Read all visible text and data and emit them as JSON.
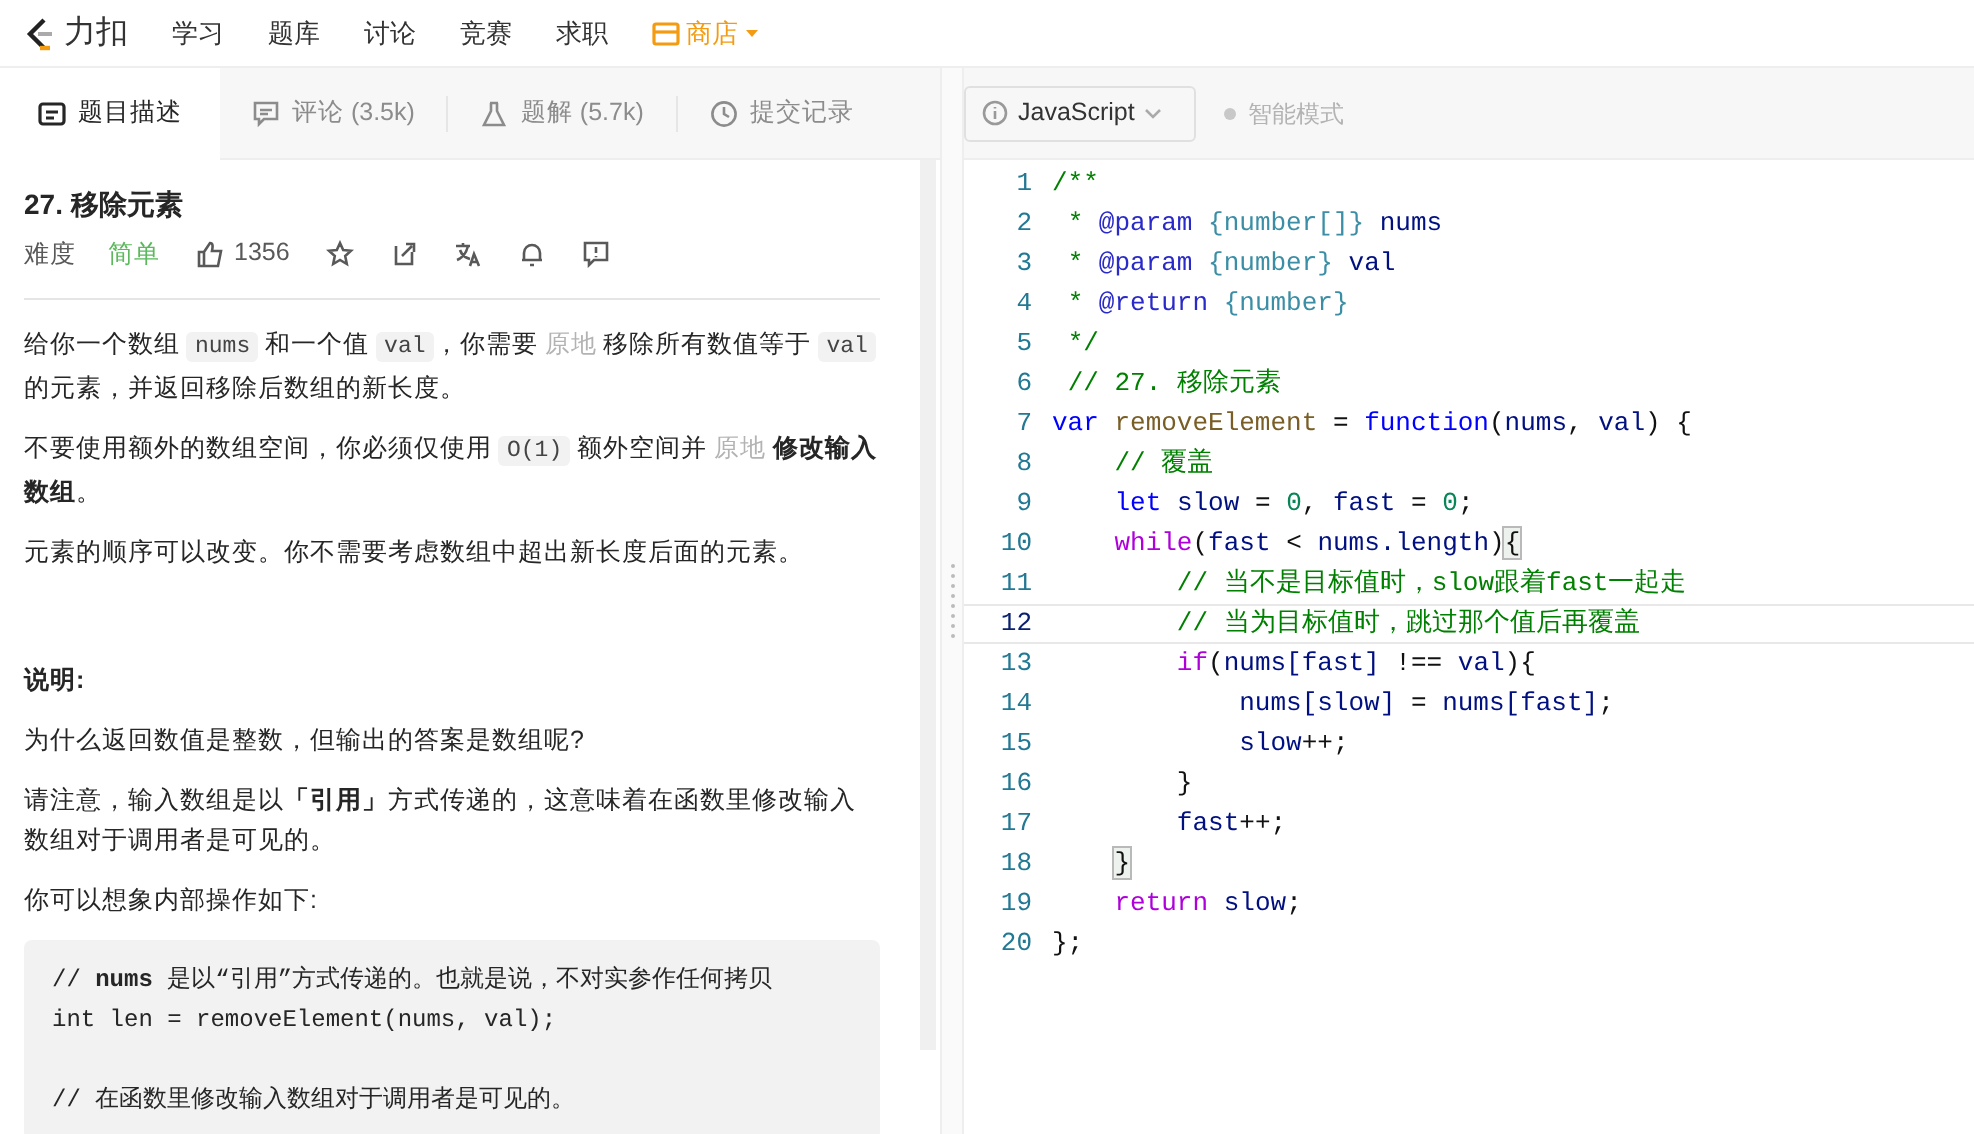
{
  "navbar": {
    "logo_text": "力扣",
    "items": [
      {
        "label": "学习",
        "kind": "link"
      },
      {
        "label": "题库",
        "kind": "link"
      },
      {
        "label": "讨论",
        "kind": "link"
      },
      {
        "label": "竞赛",
        "kind": "link"
      },
      {
        "label": "求职",
        "kind": "link"
      },
      {
        "label": "商店",
        "kind": "store"
      }
    ]
  },
  "tabs": [
    {
      "label": "题目描述",
      "selected": true
    },
    {
      "label": "评论 (3.5k)",
      "selected": false
    },
    {
      "label": "题解 (5.7k)",
      "selected": false
    },
    {
      "label": "提交记录",
      "selected": false
    }
  ],
  "problem": {
    "title": "27. 移除元素",
    "difficulty_label": "难度",
    "difficulty": "简单",
    "likes": "1356",
    "paragraphs": [
      [
        {
          "kind": "text",
          "text": "给你一个数组 "
        },
        {
          "kind": "code",
          "text": "nums"
        },
        {
          "kind": "text",
          "text": " 和一个值 "
        },
        {
          "kind": "code",
          "text": "val"
        },
        {
          "kind": "text",
          "text": "，你需要 "
        },
        {
          "kind": "muted",
          "text": "原地"
        },
        {
          "kind": "text",
          "text": " 移除所有数值等于 "
        },
        {
          "kind": "code",
          "text": "val"
        },
        {
          "kind": "text",
          "text": " 的元素，并返回移除后数组的新长度。"
        }
      ],
      [
        {
          "kind": "text",
          "text": "不要使用额外的数组空间，你必须仅使用 "
        },
        {
          "kind": "code",
          "text": "O(1)"
        },
        {
          "kind": "text",
          "text": " 额外空间并 "
        },
        {
          "kind": "muted",
          "text": "原地"
        },
        {
          "kind": "bold",
          "text": " 修改输入数组"
        },
        {
          "kind": "text",
          "text": "。"
        }
      ],
      [
        {
          "kind": "text",
          "text": "元素的顺序可以改变。你不需要考虑数组中超出新长度后面的元素。"
        }
      ]
    ],
    "note_heading": "说明:",
    "notes": [
      "为什么返回数值是整数，但输出的答案是数组呢?",
      "请注意，输入数组是以**「引用」**方式传递的，这意味着在函数里修改输入数组对于调用者是可见的。",
      "你可以想象内部操作如下:"
    ],
    "example_code": [
      [
        "// **nums** 是以“引用”方式传递的。也就是说，不对实参作任何拷贝",
        "int len = removeElement(nums, val);"
      ],
      [
        "// 在函数里修改输入数组对于调用者是可见的。"
      ]
    ]
  },
  "editor_toolbar": {
    "language": "JavaScript",
    "smart_mode": {
      "label": "智能模式",
      "on": false
    }
  },
  "editor": {
    "lines": [
      {
        "number": "1",
        "selected": false,
        "tokens": [
          {
            "kind": "comment",
            "text": "/**"
          }
        ]
      },
      {
        "number": "2",
        "selected": false,
        "tokens": [
          {
            "kind": "comment",
            "text": " * "
          },
          {
            "kind": "tag",
            "text": "@param"
          },
          {
            "kind": "type",
            "text": " {number[]}"
          },
          {
            "kind": "var",
            "text": " nums"
          }
        ]
      },
      {
        "number": "3",
        "selected": false,
        "tokens": [
          {
            "kind": "comment",
            "text": " * "
          },
          {
            "kind": "tag",
            "text": "@param"
          },
          {
            "kind": "type",
            "text": " {number}"
          },
          {
            "kind": "var",
            "text": " val"
          }
        ]
      },
      {
        "number": "4",
        "selected": false,
        "tokens": [
          {
            "kind": "comment",
            "text": " * "
          },
          {
            "kind": "tag",
            "text": "@return"
          },
          {
            "kind": "type",
            "text": " {number}"
          }
        ]
      },
      {
        "number": "5",
        "selected": false,
        "tokens": [
          {
            "kind": "comment",
            "text": " */"
          }
        ]
      },
      {
        "number": "6",
        "selected": false,
        "tokens": [
          {
            "kind": "comment",
            "text": " // 27. 移除元素"
          }
        ]
      },
      {
        "number": "7",
        "selected": false,
        "tokens": [
          {
            "kind": "decl",
            "text": "var"
          },
          {
            "kind": "func",
            "text": " removeElement"
          },
          {
            "kind": "plain",
            "text": " = "
          },
          {
            "kind": "decl",
            "text": "function"
          },
          {
            "kind": "plain",
            "text": "("
          },
          {
            "kind": "var",
            "text": "nums"
          },
          {
            "kind": "plain",
            "text": ", "
          },
          {
            "kind": "var",
            "text": "val"
          },
          {
            "kind": "plain",
            "text": ") {"
          }
        ]
      },
      {
        "number": "8",
        "selected": false,
        "tokens": [
          {
            "kind": "comment",
            "text": "    // 覆盖"
          }
        ]
      },
      {
        "number": "9",
        "selected": false,
        "tokens": [
          {
            "kind": "decl",
            "text": "    let"
          },
          {
            "kind": "var",
            "text": " slow"
          },
          {
            "kind": "plain",
            "text": " = "
          },
          {
            "kind": "num",
            "text": "0"
          },
          {
            "kind": "plain",
            "text": ", "
          },
          {
            "kind": "var",
            "text": "fast"
          },
          {
            "kind": "plain",
            "text": " = "
          },
          {
            "kind": "num",
            "text": "0"
          },
          {
            "kind": "plain",
            "text": ";"
          }
        ]
      },
      {
        "number": "10",
        "selected": false,
        "tokens": [
          {
            "kind": "control",
            "text": "    while"
          },
          {
            "kind": "plain",
            "text": "("
          },
          {
            "kind": "var",
            "text": "fast"
          },
          {
            "kind": "plain",
            "text": " < "
          },
          {
            "kind": "var",
            "text": "nums.length"
          },
          {
            "kind": "plain",
            "text": ")"
          },
          {
            "kind": "bracket",
            "text": "{"
          }
        ]
      },
      {
        "number": "11",
        "selected": false,
        "tokens": [
          {
            "kind": "comment",
            "text": "        // 当不是目标值时，slow跟着fast一起走"
          }
        ]
      },
      {
        "number": "12",
        "selected": true,
        "tokens": [
          {
            "kind": "comment",
            "text": "        // 当为目标值时，跳过那个值后再覆盖"
          }
        ]
      },
      {
        "number": "13",
        "selected": false,
        "tokens": [
          {
            "kind": "control",
            "text": "        if"
          },
          {
            "kind": "plain",
            "text": "("
          },
          {
            "kind": "var",
            "text": "nums[fast]"
          },
          {
            "kind": "plain",
            "text": " !== "
          },
          {
            "kind": "var",
            "text": "val"
          },
          {
            "kind": "plain",
            "text": "){"
          }
        ]
      },
      {
        "number": "14",
        "selected": false,
        "tokens": [
          {
            "kind": "var",
            "text": "            nums[slow]"
          },
          {
            "kind": "plain",
            "text": " = "
          },
          {
            "kind": "var",
            "text": "nums[fast]"
          },
          {
            "kind": "plain",
            "text": ";"
          }
        ]
      },
      {
        "number": "15",
        "selected": false,
        "tokens": [
          {
            "kind": "var",
            "text": "            slow"
          },
          {
            "kind": "plain",
            "text": "++;"
          }
        ]
      },
      {
        "number": "16",
        "selected": false,
        "tokens": [
          {
            "kind": "plain",
            "text": "        }"
          }
        ]
      },
      {
        "number": "17",
        "selected": false,
        "tokens": [
          {
            "kind": "var",
            "text": "        fast"
          },
          {
            "kind": "plain",
            "text": "++;"
          }
        ]
      },
      {
        "number": "18",
        "selected": false,
        "tokens": [
          {
            "kind": "bracket",
            "text": "    }"
          }
        ]
      },
      {
        "number": "19",
        "selected": false,
        "tokens": [
          {
            "kind": "control",
            "text": "    return"
          },
          {
            "kind": "var",
            "text": " slow"
          },
          {
            "kind": "plain",
            "text": ";"
          }
        ]
      },
      {
        "number": "20",
        "selected": false,
        "tokens": [
          {
            "kind": "plain",
            "text": "};"
          }
        ]
      }
    ]
  }
}
